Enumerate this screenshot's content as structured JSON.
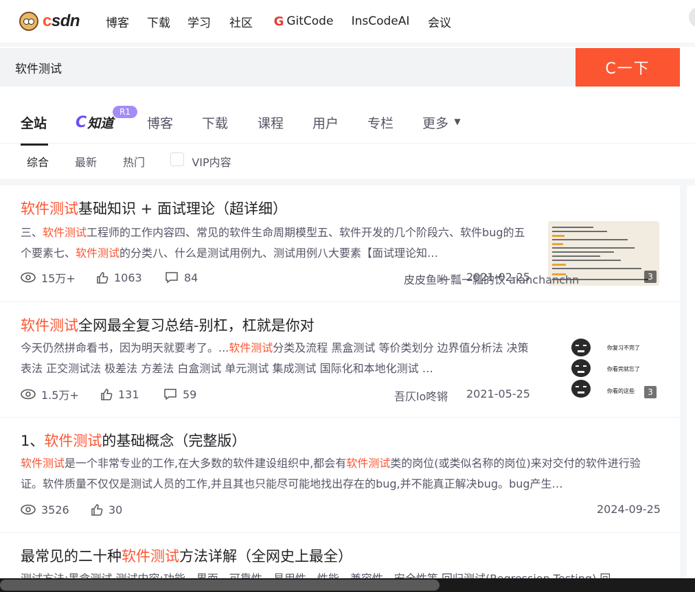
{
  "nav": {
    "logo_text_1": "c",
    "logo_text_2": "sdn",
    "links": [
      "博客",
      "下载",
      "学习",
      "社区",
      "GitCode",
      "InsCodeAI",
      "会议"
    ],
    "gitcode_glyph": "G"
  },
  "search": {
    "query": "软件测试",
    "button_label": "C一下"
  },
  "tabs": {
    "items": [
      "全站",
      "知道",
      "博客",
      "下载",
      "课程",
      "用户",
      "专栏",
      "更多"
    ],
    "active": "全站",
    "badge": "R1",
    "zhidao_glyph": "C"
  },
  "filters": {
    "items": [
      "综合",
      "最新",
      "热门",
      "VIP内容"
    ],
    "active": "综合"
  },
  "results": [
    {
      "title_hl": "软件测试",
      "title_rest": "基础知识 + 面试理论（超详细）",
      "desc_html_parts": [
        "三、",
        "软件测试",
        "工程师的工作内容四、常见的软件生命周期模型五、软件开发的几个阶段六、软件bug的五个要素七、",
        "软件测试",
        "的分类八、什么是测试用例九、测试用例八大要素【面试理论知…"
      ],
      "views": "15万+",
      "likes": "1063",
      "comments": "84",
      "author": "皮皮鱼哟",
      "date": "2021-02-25",
      "image_count": "3"
    },
    {
      "title_hl": "软件测试",
      "title_rest": "全网最全复习总结-别杠，杠就是你对",
      "desc_html_parts": [
        "今天仍然拼命看书，因为明天就要考了。...",
        "软件测试",
        "分类及流程 黑盒测试 等价类划分 边界值分析法 决策表法 正交测试法 极差法 方差法 白盒测试 单元测试 集成测试 国际化和本地化测试 …"
      ],
      "views": "1.5万+",
      "likes": "131",
      "comments": "59",
      "author": "吾仄lo咚锵",
      "date": "2021-05-25",
      "image_count": "3",
      "meme_lines": [
        "你复习不完了",
        "你看完就忘了",
        "你看的这些"
      ]
    },
    {
      "title_prefix": "1、",
      "title_hl": "软件测试",
      "title_rest": "的基础概念（完整版）",
      "desc_html_parts": [
        "",
        "软件测试",
        "是一个非常专业的工作,在大多数的软件建设组织中,都会有",
        "软件测试",
        "类的岗位(或类似名称的岗位)来对交付的软件进行验证。软件质量不仅仅是测试人员的工作,并且其也只能尽可能地找出存在的bug,并不能真正解决bug。bug产生…"
      ],
      "views": "3526",
      "likes": "30",
      "author": "一瓢一瓢的饮 alanchanchn",
      "date": "2024-09-25"
    },
    {
      "title_prefix": "最常见的二十种",
      "title_hl": "软件测试",
      "title_rest": "方法详解（全网史上最全）",
      "desc_html_parts": [
        "测试方法:黑盒测试 测试内容:功能、界面、可靠性、易用性、性能、兼容性、安全性等 回归测试(Regression Testing) 回…"
      ]
    }
  ]
}
